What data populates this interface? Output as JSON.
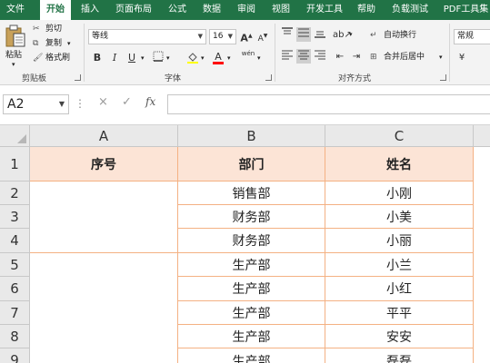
{
  "ribbon": {
    "tabs": [
      "文件",
      "开始",
      "插入",
      "页面布局",
      "公式",
      "数据",
      "审阅",
      "视图",
      "开发工具",
      "帮助",
      "负载测试",
      "PDF工具集"
    ],
    "active_tab": "开始",
    "clipboard": {
      "paste": "粘贴",
      "cut": "剪切",
      "copy": "复制",
      "format_painter": "格式刷",
      "group_label": "剪贴板"
    },
    "font": {
      "font_name": "等线",
      "font_size": "16",
      "bold": "B",
      "italic": "I",
      "underline": "U",
      "grow": "A",
      "shrink": "A",
      "font_color_glyph": "A",
      "phonetic": "wén",
      "group_label": "字体"
    },
    "alignment": {
      "wrap_text": "自动换行",
      "merge_center": "合并后居中",
      "group_label": "对齐方式"
    },
    "number": {
      "format": "常规"
    }
  },
  "formula_bar": {
    "name_box": "A2",
    "cancel_icon": "×",
    "enter_icon": "✓",
    "fx_label": "fx",
    "value": ""
  },
  "sheet": {
    "columns": [
      "A",
      "B",
      "C"
    ],
    "rows": [
      "1",
      "2",
      "3",
      "4",
      "5",
      "6",
      "7",
      "8",
      "9"
    ],
    "header": {
      "a": "序号",
      "b": "部门",
      "c": "姓名"
    },
    "records": [
      {
        "dept": "销售部",
        "name": "小刚"
      },
      {
        "dept": "财务部",
        "name": "小美"
      },
      {
        "dept": "财务部",
        "name": "小丽"
      },
      {
        "dept": "生产部",
        "name": "小兰"
      },
      {
        "dept": "生产部",
        "name": "小红"
      },
      {
        "dept": "生产部",
        "name": "平平"
      },
      {
        "dept": "生产部",
        "name": "安安"
      },
      {
        "dept": "生产部",
        "name": "磊磊"
      }
    ]
  },
  "colors": {
    "excel_green": "#217346",
    "header_fill": "#fce4d6",
    "border_orange": "#f4b183"
  }
}
